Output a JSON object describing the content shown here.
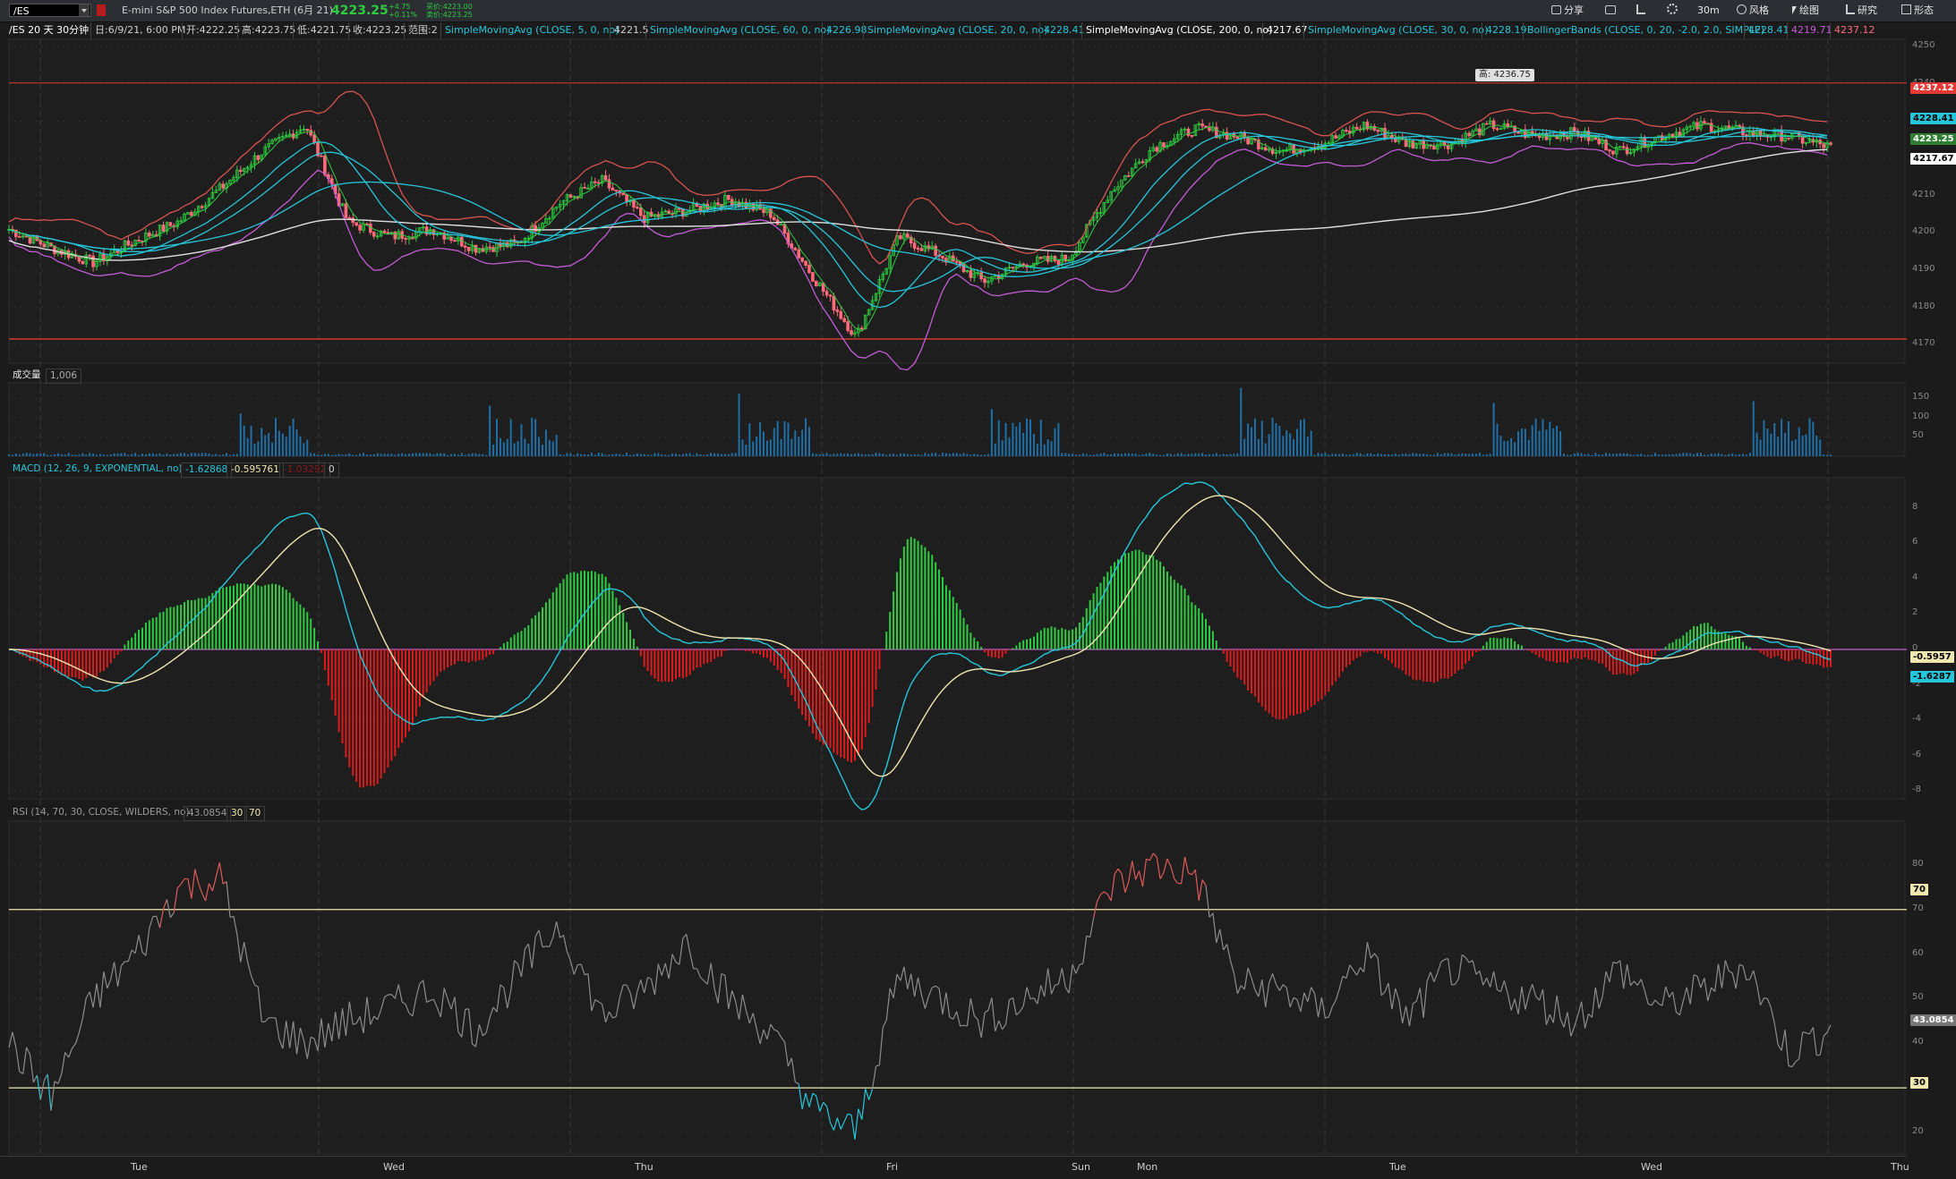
{
  "toolbar": {
    "symbol": "/ES",
    "name": "E-mini S&P 500 Index Futures,ETH (6月 21)",
    "last_price": "4223.25",
    "change": "+4.75",
    "change_pct": "+0.11%",
    "bid": "买价:4223.00",
    "ask": "卖价:4223.25",
    "share_label": "分享",
    "interval": "30m",
    "style_label": "风格",
    "drawing_label": "绘图",
    "studies_label": "研究",
    "pattern_label": "形态"
  },
  "infobar": {
    "title": "/ES 20 天 30分钟",
    "date": "日:6/9/21, 6:00 PM",
    "open": "开:4222.25",
    "high": "高:4223.75",
    "low": "低:4221.75",
    "close": "收:4223.25",
    "range": "范围:2",
    "studies": [
      {
        "label": "SimpleMovingAvg (CLOSE, 5, 0, no)",
        "value": "4221.5"
      },
      {
        "label": "SimpleMovingAvg (CLOSE, 60, 0, no)",
        "value": "4226.98"
      },
      {
        "label": "SimpleMovingAvg (CLOSE, 20, 0, no)",
        "value": "4228.41"
      },
      {
        "label": "SimpleMovingAvg (CLOSE, 200, 0, no)",
        "value": "4217.67"
      },
      {
        "label": "SimpleMovingAvg (CLOSE, 30, 0, no)",
        "value": "4228.19"
      },
      {
        "label": "BollingerBands (CLOSE, 0, 20, -2.0, 2.0, SIMPLE)",
        "value": "4228.41"
      }
    ],
    "bb_lower": "4219.71",
    "bb_upper": "4237.12"
  },
  "price_panel": {
    "high_tag": "高: 4236.75",
    "axis_ticks": [
      "4250",
      "4240",
      "4230",
      "4220",
      "4210",
      "4200",
      "4190",
      "4180",
      "4170"
    ],
    "tags": [
      {
        "text": "4237.12",
        "color": "#e53935"
      },
      {
        "text": "4228.41",
        "color": "#26c6da"
      },
      {
        "text": "4223.25",
        "color": "#2e7d32"
      },
      {
        "text": "4217.67",
        "color": "#ffffff"
      }
    ]
  },
  "volume_panel": {
    "label": "成交量",
    "value": "1,006",
    "axis_ticks": [
      "150",
      "100",
      "50"
    ]
  },
  "macd_panel": {
    "label": "MACD (12, 26, 9, EXPONENTIAL, no)",
    "value": "-1.62868",
    "avg": "-0.595761",
    "diff": "-1.03292",
    "zero": "0",
    "axis_ticks": [
      "8",
      "6",
      "4",
      "2",
      "0",
      "-2",
      "-4",
      "-6",
      "-8"
    ],
    "tags": [
      {
        "text": "-0.5957",
        "color": "#f0e6b0"
      },
      {
        "text": "-1.6287",
        "color": "#26c6da"
      }
    ]
  },
  "rsi_panel": {
    "label": "RSI (14, 70, 30, CLOSE, WILDERS, no)",
    "value": "43.0854",
    "oversold": "30",
    "overbought": "70",
    "axis_ticks": [
      "80",
      "70",
      "60",
      "50",
      "40",
      "30",
      "20"
    ],
    "tag": "43.0854"
  },
  "time_axis": [
    "Tue",
    "Wed",
    "Thu",
    "Fri",
    "Sun",
    "Mon",
    "Tue",
    "Wed",
    "Thu"
  ],
  "colors": {
    "up": "#2ecc40",
    "down": "#ff6b7a",
    "sma_cyan": "#26c6da",
    "bb_upper": "#d9534f",
    "bb_lower": "#c45bd6",
    "sma200": "#e0e0e0",
    "macd": "#26c6da",
    "macd_avg": "#f0e6b0"
  },
  "chart_data": {
    "type": "line",
    "price_close_approx": [
      4201,
      4196,
      4192,
      4198,
      4203,
      4212,
      4222,
      4229,
      4203,
      4199,
      4201,
      4196,
      4197,
      4208,
      4214,
      4204,
      4206,
      4209,
      4205,
      4188,
      4172,
      4199,
      4194,
      4187,
      4192,
      4193,
      4211,
      4223,
      4228,
      4226,
      4222,
      4224,
      4229,
      4224,
      4224,
      4229,
      4226,
      4227,
      4222,
      4226,
      4229,
      4227,
      4226,
      4223
    ],
    "rsi_approx": [
      40,
      28,
      50,
      60,
      75,
      77,
      45,
      40,
      45,
      48,
      52,
      43,
      55,
      67,
      46,
      52,
      63,
      50,
      42,
      25,
      20,
      55,
      50,
      45,
      50,
      55,
      75,
      80,
      78,
      53,
      52,
      47,
      60,
      45,
      57,
      52,
      50,
      45,
      57,
      48,
      52,
      58,
      38,
      43
    ]
  }
}
